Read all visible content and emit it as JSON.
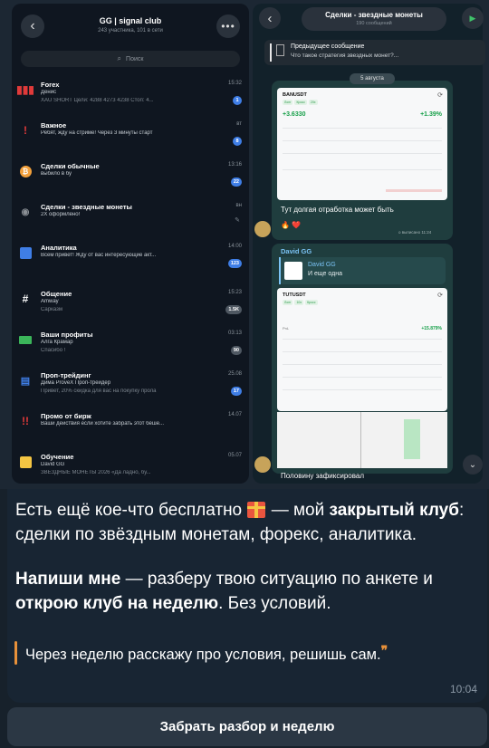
{
  "left_panel": {
    "title": "GG | signal club",
    "subtitle": "243 участника, 101 в сети",
    "search_placeholder": "Поиск",
    "chats": [
      {
        "name": "Forex",
        "line2": "Денис",
        "line3": "XAU SHORT Цели: 4288 4273 4238 Стоп: 4...",
        "time": "15:32",
        "badge": "1",
        "icon": "bar-chart-icon",
        "color": "#e03a3a"
      },
      {
        "name": "Важное",
        "line2": "Ребят, жду на стриме! Через 3 минуты старт",
        "line3": "",
        "time": "вт",
        "badge": "8",
        "icon": "exclamation-icon",
        "color": "#e03a3a"
      },
      {
        "name": "Сделки обычные",
        "line2": "выбило в бу",
        "line3": "",
        "time": "13:16",
        "badge": "22",
        "icon": "bitcoin-icon",
        "color": "#f2a03b"
      },
      {
        "name": "Сделки - звездные монеты",
        "line2": "2Х оформлено!",
        "line3": "",
        "time": "вн",
        "badge": "",
        "icon": "coins-icon",
        "color": "#8a8f95"
      },
      {
        "name": "Аналитика",
        "line2": "Всем привет! Жду от вас интересующие акт...",
        "line3": "",
        "time": "14:00",
        "badge": "123",
        "icon": "analytics-icon",
        "color": "#3f7ee6"
      }
    ]
  },
  "dark_list": {
    "chats": [
      {
        "name": "Общение",
        "line2": "Amway",
        "line3": "Сарказм",
        "time": "15:23",
        "badge": "1.5K",
        "icon": "hash-icon"
      },
      {
        "name": "Ваши профиты",
        "line2": "Алга Крамар",
        "line3": "Спасибо !",
        "time": "03:13",
        "badge": "90",
        "icon": "money-icon"
      },
      {
        "name": "Проп-трейдинг",
        "line2": "Дима ProveX Проп-трейдер",
        "line3": "Привет, 20% скидка для вас на покупку прола",
        "time": "25.08",
        "badge": "17",
        "icon": "chart-icon"
      },
      {
        "name": "Промо от бирж",
        "line2": "Ваши действия если хотите забрать этот беше...",
        "line3": "",
        "time": "14.07",
        "badge": "",
        "icon": "exclamation-icon"
      },
      {
        "name": "Обучение",
        "line2": "David GG",
        "line3": "ЗВЕЗДНЫЕ МОНЕТЫ 2026 «Да ладно, бу...",
        "time": "05.07",
        "badge": "",
        "icon": "book-icon"
      }
    ]
  },
  "right_panel": {
    "title": "Сделки - звездные монеты",
    "subtitle": "190 сообщений",
    "prev_label": "Предыдущее сообщение",
    "prev_text": "Что такое стратегия звездных монет?...",
    "date": "5 августа",
    "card1_symbol": "BANUSDT",
    "card1_value": "+3.6330",
    "card1_pct": "+1.39%",
    "bubble1_text": "Тут долгая отработка может быть",
    "bubble1_time": "о выписано 11:24",
    "bubble2_from": "David GG",
    "reply_name": "David GG",
    "reply_text": "И еще одна",
    "card2_symbol": "TUTUSDT",
    "card2_value": "+15.879%",
    "bubble2_text": "Половину зафиксировал"
  },
  "message": {
    "p1_a": "Есть ещё кое-что бесплатно",
    "p1_b": " — мой ",
    "p1_bold": "закрытый клуб",
    "p1_c": ": сделки по звёздным монетам, форекс, аналитика.",
    "p2_bold": "Напиши мне",
    "p2_a": " — разберу твою ситуацию по анкете и ",
    "p2_bold2": "открою клуб на неделю",
    "p2_b": ". Без условий.",
    "quote": "Через неделю расскажу про условия, решишь сам.",
    "time": "10:04"
  },
  "cta": {
    "label": "Забрать разбор и неделю"
  }
}
